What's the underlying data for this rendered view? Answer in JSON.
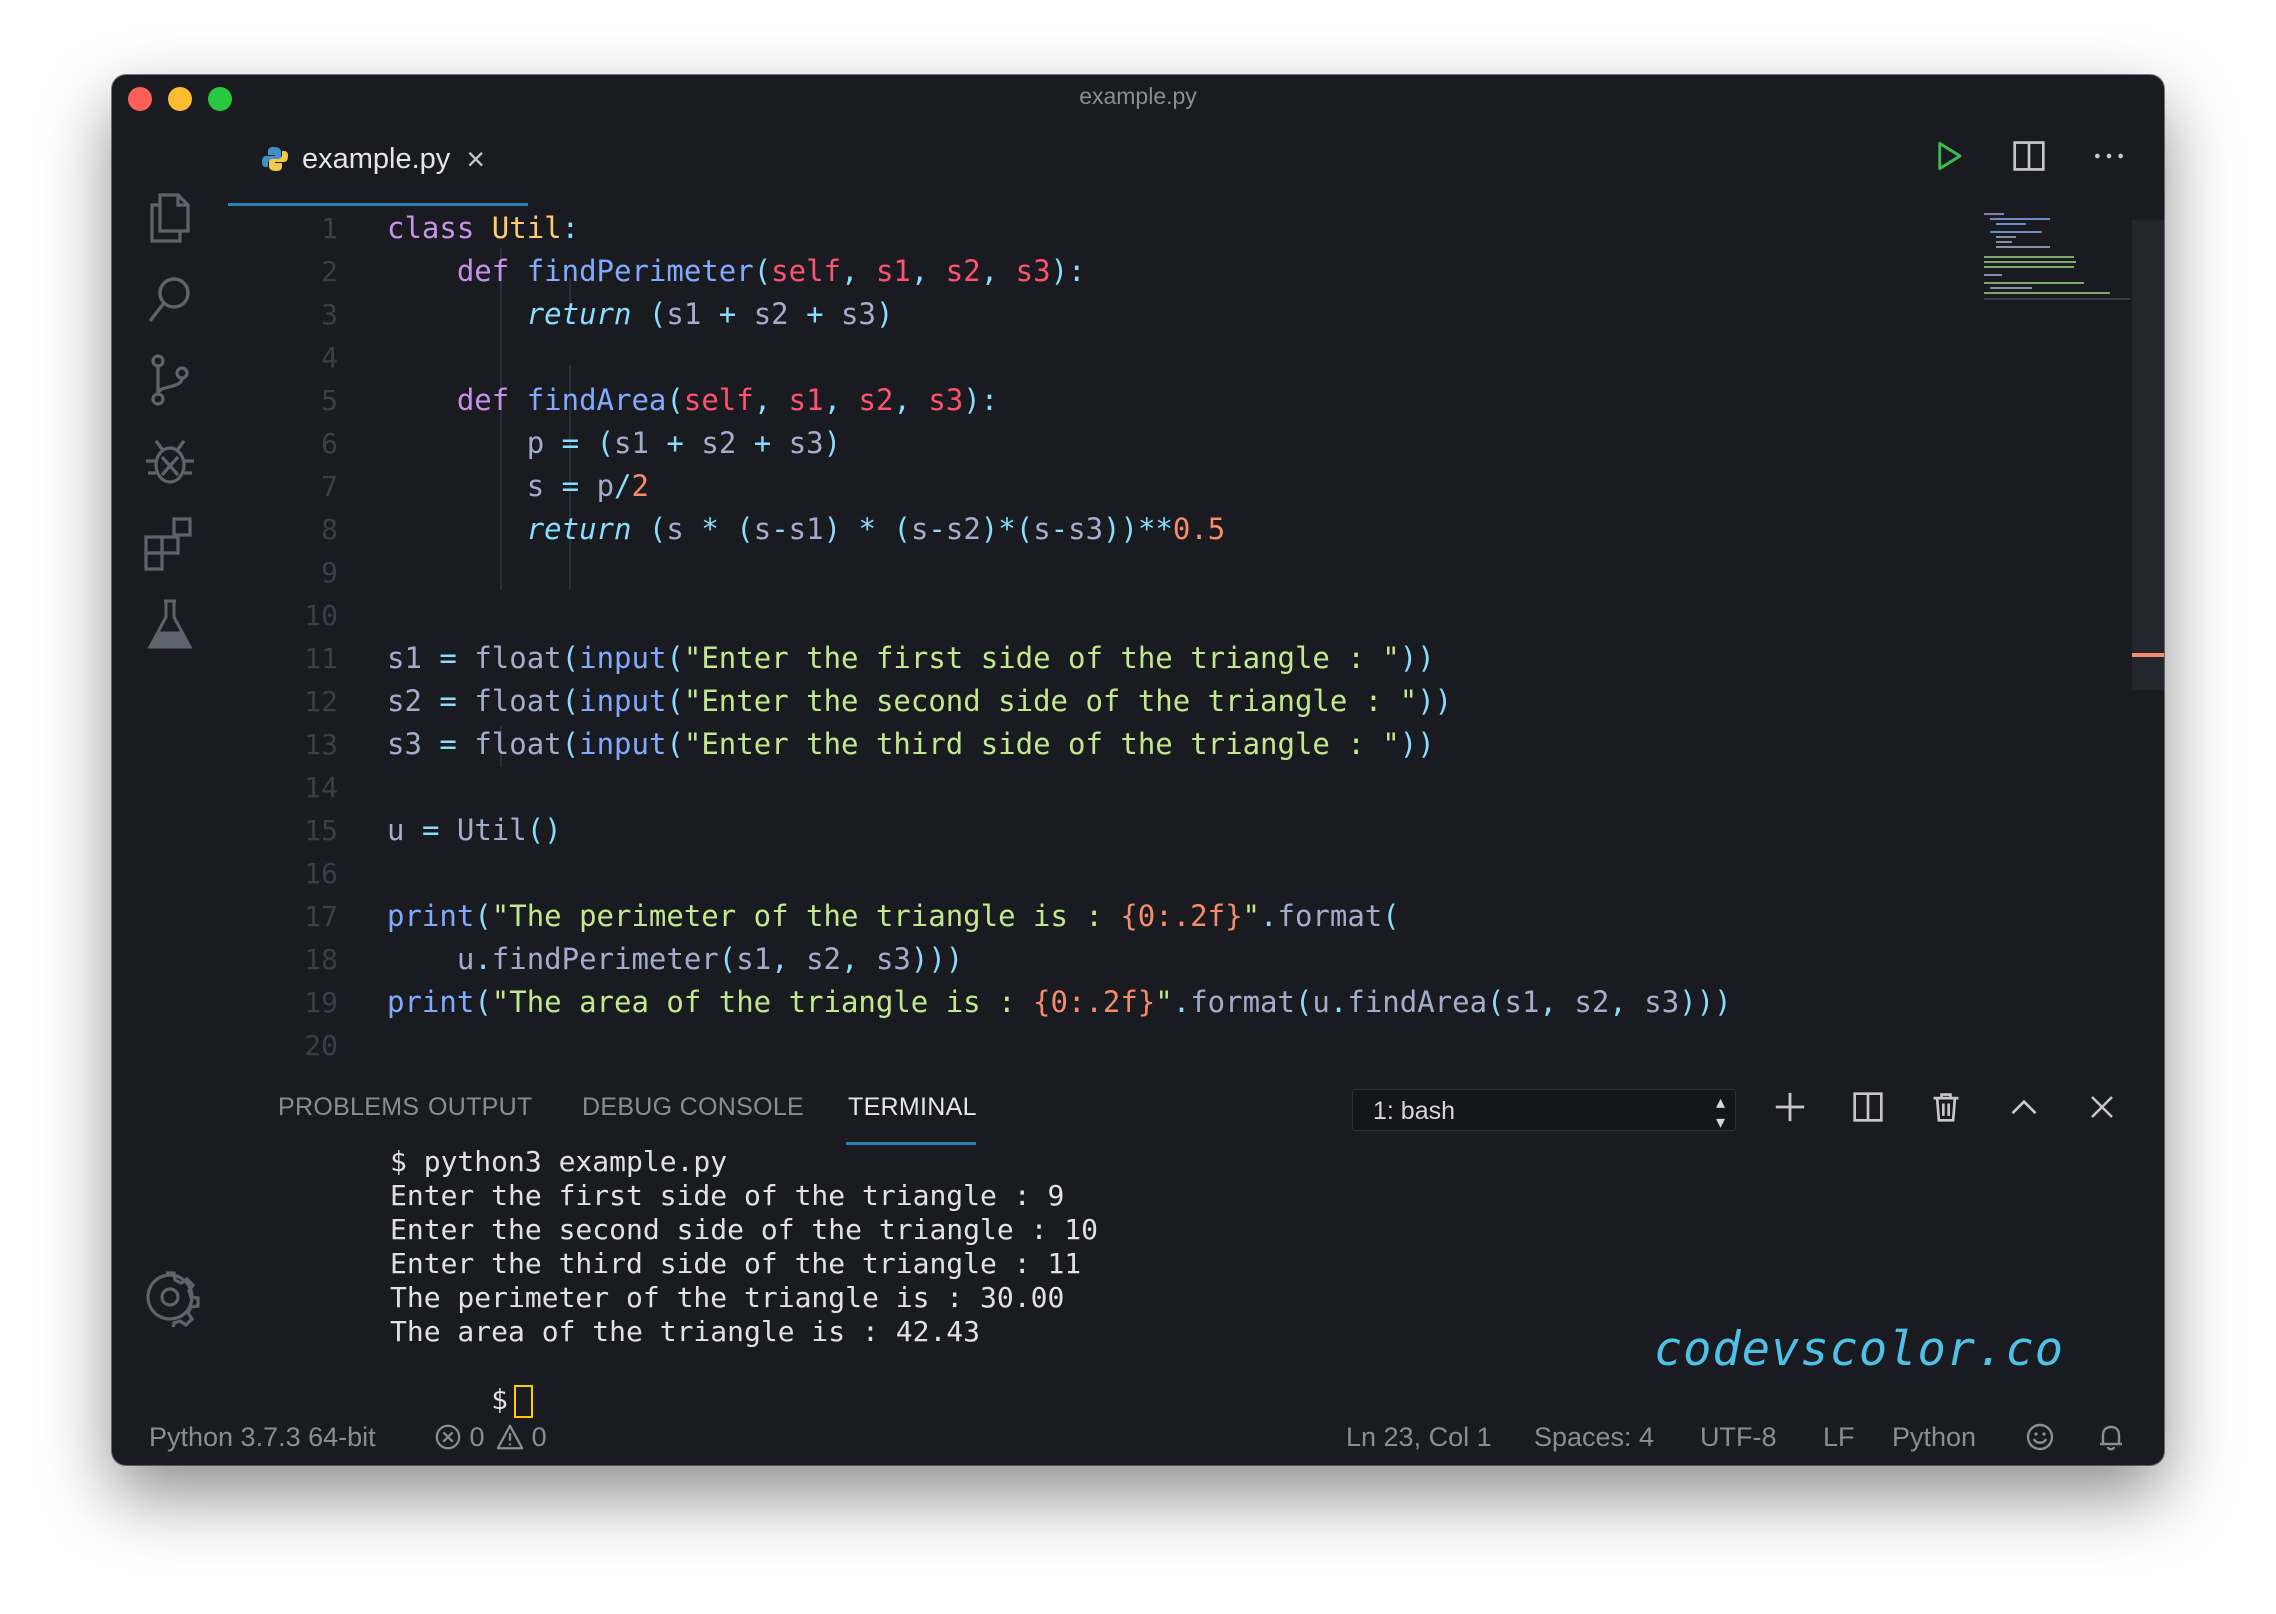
{
  "window": {
    "title": "example.py"
  },
  "tab": {
    "label": "example.py",
    "close": "×"
  },
  "editor": {
    "line_numbers": [
      "1",
      "2",
      "3",
      "4",
      "5",
      "6",
      "7",
      "8",
      "9",
      "10",
      "11",
      "12",
      "13",
      "14",
      "15",
      "16",
      "17",
      "18",
      "19",
      "20"
    ]
  },
  "panel": {
    "tabs": [
      "PROBLEMS",
      "OUTPUT",
      "DEBUG CONSOLE",
      "TERMINAL"
    ],
    "active_tab": "TERMINAL",
    "terminal_select": "1: bash",
    "terminal_lines": [
      "$ python3 example.py",
      "Enter the first side of the triangle : 9",
      "Enter the second side of the triangle : 10",
      "Enter the third side of the triangle : 11",
      "The perimeter of the triangle is : 30.00",
      "The area of the triangle is : 42.43"
    ],
    "prompt": "$",
    "watermark": "codevscolor.co"
  },
  "statusbar": {
    "interpreter": "Python 3.7.3 64-bit",
    "errors": "0",
    "warnings": "0",
    "position": "Ln 23, Col 1",
    "spaces": "Spaces: 4",
    "encoding": "UTF-8",
    "eol": "LF",
    "language": "Python"
  },
  "icons": {
    "activity": [
      "files-icon",
      "search-icon",
      "source-control-icon",
      "debug-icon",
      "extensions-icon",
      "test-flask-icon",
      "settings-gear-icon"
    ],
    "editor_actions": [
      "run-icon",
      "split-editor-icon",
      "more-icon"
    ],
    "panel_actions": [
      "new-terminal-icon",
      "split-terminal-icon",
      "trash-icon",
      "maximize-panel-icon",
      "close-panel-icon"
    ]
  },
  "colors": {
    "background": "#1a1b20",
    "accent": "#2a82b0",
    "keyword": "#c792ea",
    "function": "#82aaff",
    "string": "#c3e88d",
    "number": "#f78c6c",
    "class": "#ffcb6b",
    "parameter": "#ff5370",
    "run": "#3fb950",
    "cursor": "#ffcc00",
    "watermark": "#4fc1e9"
  }
}
